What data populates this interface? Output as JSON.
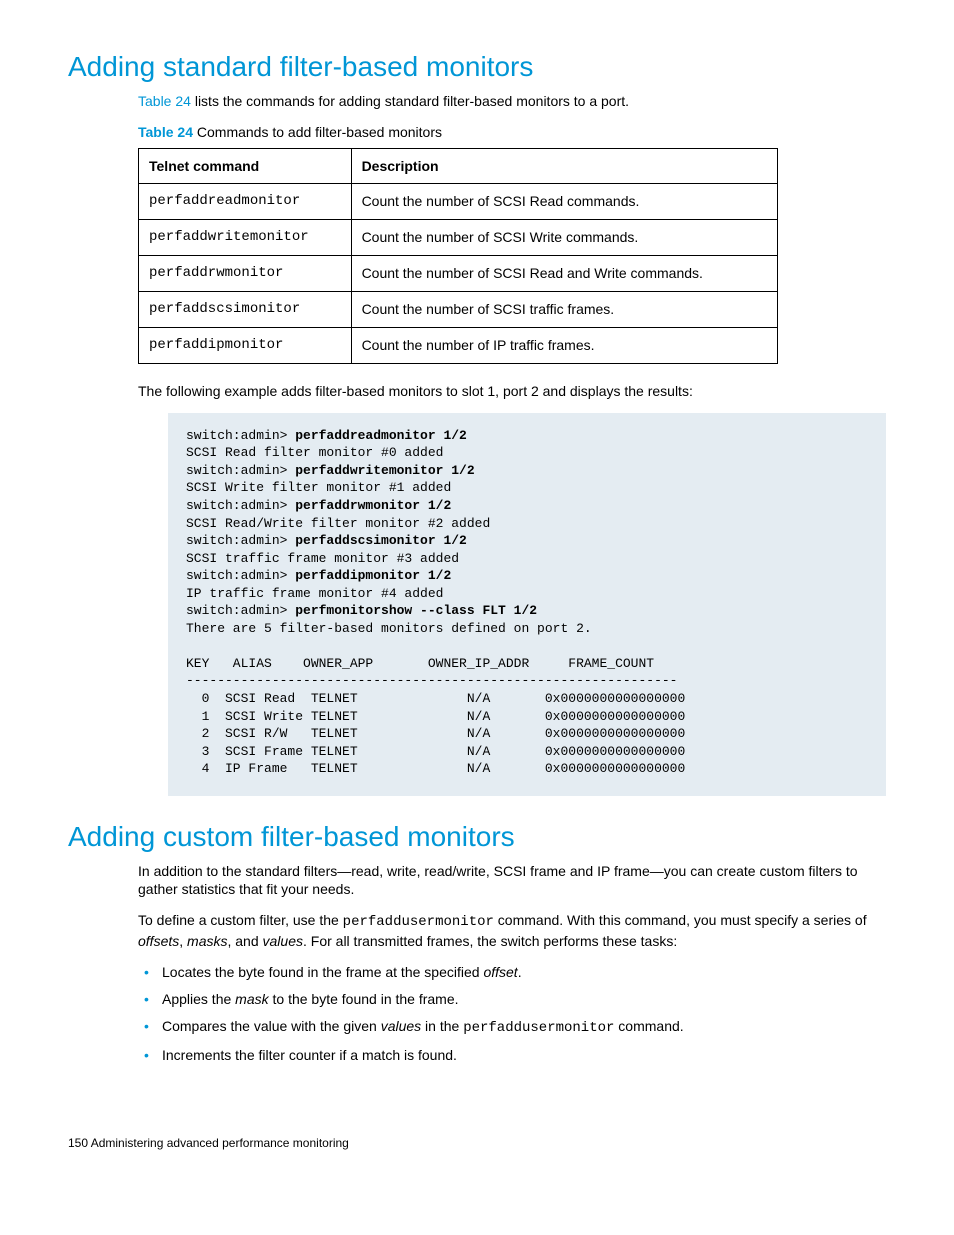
{
  "section1": {
    "title": "Adding standard filter-based monitors",
    "intro_link": "Table 24",
    "intro_rest": " lists the commands for adding standard filter-based monitors to a port.",
    "caption_num": "Table 24",
    "caption_text": "   Commands to add filter-based monitors",
    "th1": "Telnet command",
    "th2": "Description",
    "rows": [
      {
        "cmd": "perfaddreadmonitor",
        "desc": "Count the number of SCSI Read commands."
      },
      {
        "cmd": "perfaddwritemonitor",
        "desc": "Count the number of SCSI Write commands."
      },
      {
        "cmd": "perfaddrwmonitor",
        "desc": "Count the number of SCSI Read and Write commands."
      },
      {
        "cmd": "perfaddscsimonitor",
        "desc": "Count the number of SCSI traffic frames."
      },
      {
        "cmd": "perfaddipmonitor",
        "desc": "Count the number of IP traffic frames."
      }
    ],
    "example_intro": "The following example adds filter-based monitors to slot 1, port 2 and displays the results:",
    "code": {
      "l1a": "switch:admin> ",
      "l1b": "perfaddreadmonitor 1/2",
      "l2": "SCSI Read filter monitor #0 added",
      "l3a": "switch:admin> ",
      "l3b": "perfaddwritemonitor 1/2",
      "l4": "SCSI Write filter monitor #1 added",
      "l5a": "switch:admin> ",
      "l5b": "perfaddrwmonitor 1/2",
      "l6": "SCSI Read/Write filter monitor #2 added",
      "l7a": "switch:admin> ",
      "l7b": "perfaddscsimonitor 1/2",
      "l8": "SCSI traffic frame monitor #3 added",
      "l9a": "switch:admin> ",
      "l9b": "perfaddipmonitor 1/2",
      "l10": "IP traffic frame monitor #4 added",
      "l11a": "switch:admin> ",
      "l11b": "perfmonitorshow --class FLT 1/2",
      "l12": "There are 5 filter-based monitors defined on port 2.",
      "blank": "",
      "hdr": "KEY   ALIAS    OWNER_APP       OWNER_IP_ADDR     FRAME_COUNT",
      "rule": "---------------------------------------------------------------",
      "r0": "  0  SCSI Read  TELNET              N/A       0x0000000000000000",
      "r1": "  1  SCSI Write TELNET              N/A       0x0000000000000000",
      "r2": "  2  SCSI R/W   TELNET              N/A       0x0000000000000000",
      "r3": "  3  SCSI Frame TELNET              N/A       0x0000000000000000",
      "r4": "  4  IP Frame   TELNET              N/A       0x0000000000000000"
    }
  },
  "section2": {
    "title": "Adding custom filter-based monitors",
    "p1": "In addition to the standard filters—read, write, read/write, SCSI frame and IP frame—you can create custom filters to gather statistics that fit your needs.",
    "p2a": "To define a custom filter, use the ",
    "p2cmd": "perfaddusermonitor",
    "p2b": " command. With this command, you must specify a series of ",
    "p2i1": "offsets",
    "p2c": ", ",
    "p2i2": "masks",
    "p2d": ", and ",
    "p2i3": "values",
    "p2e": ". For all transmitted frames, the switch performs these tasks:",
    "bullets": {
      "b1a": "Locates the byte found in the frame at the specified ",
      "b1i": "offset",
      "b1b": ".",
      "b2a": "Applies the ",
      "b2i": "mask",
      "b2b": " to the byte found in the frame.",
      "b3a": "Compares the value with the given ",
      "b3i": "values",
      "b3b": " in the ",
      "b3cmd": "perfaddusermonitor",
      "b3c": " command.",
      "b4": "Increments the filter counter if a match is found."
    }
  },
  "footer": {
    "page": "150",
    "title": "   Administering advanced performance monitoring"
  }
}
